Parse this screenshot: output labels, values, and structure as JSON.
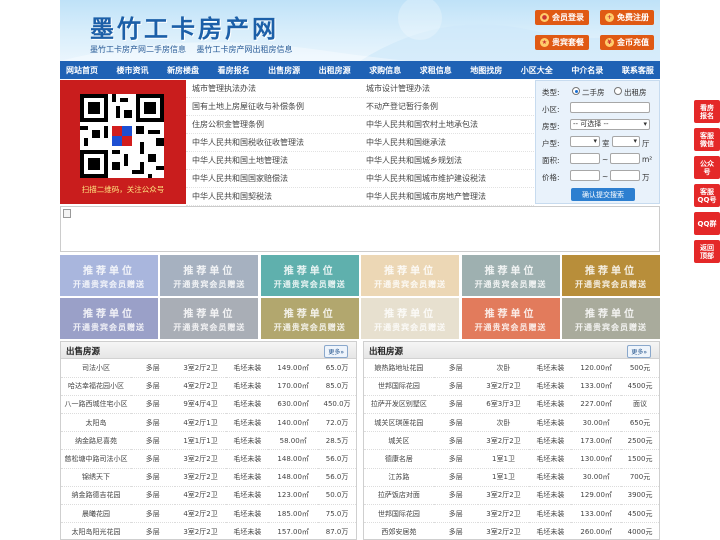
{
  "site": {
    "logo_text": "墨竹工卡房产网",
    "sublinks": [
      "墨竹工卡房产网二手房信息",
      "墨竹工卡房产网出租房信息"
    ],
    "buttons": [
      {
        "label": "会员登录",
        "icon": "user-icon"
      },
      {
        "label": "免费注册",
        "icon": "register-icon"
      },
      {
        "label": "贵宾套餐",
        "icon": "vip-icon"
      },
      {
        "label": "金币充值",
        "icon": "coin-icon"
      }
    ]
  },
  "nav": [
    "网站首页",
    "楼市资讯",
    "新房楼盘",
    "看房报名",
    "出售房源",
    "出租房源",
    "求购信息",
    "求租信息",
    "地图找房",
    "小区大全",
    "中介名录",
    "联系客服"
  ],
  "qr": {
    "caption": "扫描二维码，关注公众号"
  },
  "news_links": [
    [
      "城市管理执法办法",
      "城市设计管理办法"
    ],
    [
      "国有土地上房屋征收与补偿条例",
      "不动产登记暂行条例"
    ],
    [
      "住房公积金管理条例",
      "中华人民共和国农村土地承包法"
    ],
    [
      "中华人民共和国税收征收管理法",
      "中华人民共和国继承法"
    ],
    [
      "中华人民共和国土地管理法",
      "中华人民共和国城乡规划法"
    ],
    [
      "中华人民共和国国家赔偿法",
      "中华人民共和国城市维护建设税法"
    ],
    [
      "中华人民共和国契税法",
      "中华人民共和国城市房地产管理法"
    ]
  ],
  "search": {
    "type_label": "类型:",
    "type_options": [
      "二手房",
      "出租房"
    ],
    "community_label": "小区:",
    "community_value": "",
    "housetype_label": "房型:",
    "housetype_value": "-- 可选择 --",
    "layout_label": "户型:",
    "room_unit": "室",
    "hall_unit": "厅",
    "area_label": "面积:",
    "area_unit": "m²",
    "price_label": "价格:",
    "price_unit": "万",
    "range_sep": "~",
    "submit": "确认提交搜索"
  },
  "ads": {
    "line1": "推荐单位",
    "line2": "开通贵宾会员赠送",
    "colors": [
      "#a9b6dd",
      "#a6b1c0",
      "#5fb0ad",
      "#ecd7b5",
      "#9eb0b0",
      "#b88e3a",
      "#9aa0c8",
      "#a9aeb6",
      "#b2a76e",
      "#e7e0cf",
      "#e27b5c",
      "#a9ab9c"
    ]
  },
  "sale": {
    "title": "出售房源",
    "more": "更多»",
    "rows": [
      [
        "司法小区",
        "多层",
        "3室2厅2卫",
        "毛坯未装",
        "149.00㎡",
        "65.0万"
      ],
      [
        "哈达幸福花园小区",
        "多层",
        "4室2厅2卫",
        "170.00㎡",
        "85.0万"
      ],
      [
        "八一路西城住宅小区",
        "多层",
        "9室4厅4卫",
        "630.00㎡",
        "450.0万"
      ],
      [
        "太阳岛",
        "多层",
        "4室2厅1卫",
        "140.00㎡",
        "72.0万"
      ],
      [
        "纳金路尼喜苑",
        "多层",
        "1室1厅1卫",
        "58.00㎡",
        "28.5万"
      ],
      [
        "慈松塘中路司法小区",
        "多层",
        "3室2厅2卫",
        "148.00㎡",
        "56.0万"
      ],
      [
        "锦绣天下",
        "多层",
        "3室2厅2卫",
        "148.00㎡",
        "56.0万"
      ],
      [
        "纳金路德吉花园",
        "多层",
        "4室2厅2卫",
        "123.00㎡",
        "50.0万"
      ],
      [
        "晨曦花园",
        "多层",
        "4室2厅2卫",
        "185.00㎡",
        "75.0万"
      ],
      [
        "太阳岛阳光花园",
        "多层",
        "3室2厅2卫",
        "157.00㎡",
        "87.0万"
      ]
    ],
    "decor": "毛坯未装"
  },
  "rent": {
    "title": "出租房源",
    "more": "更多»",
    "rows": [
      [
        "娘热路地址花园",
        "多层",
        "次卧",
        "毛坯未装",
        "120.00㎡",
        "500元"
      ],
      [
        "世邦国际花园",
        "多层",
        "3室2厅2卫",
        "毛坯未装",
        "133.00㎡",
        "4500元"
      ],
      [
        "拉萨开发区别墅区",
        "多层",
        "6室3厅3卫",
        "毛坯未装",
        "227.00㎡",
        "面议"
      ],
      [
        "城关区琪莲花园",
        "多层",
        "次卧",
        "毛坯未装",
        "30.00㎡",
        "650元"
      ],
      [
        "城关区",
        "多层",
        "3室2厅2卫",
        "毛坯未装",
        "173.00㎡",
        "2500元"
      ],
      [
        "德康名居",
        "多层",
        "1室1卫",
        "毛坯未装",
        "130.00㎡",
        "1500元"
      ],
      [
        "江苏路",
        "多层",
        "1室1卫",
        "毛坯未装",
        "30.00㎡",
        "700元"
      ],
      [
        "拉萨饭店对面",
        "多层",
        "3室2厅2卫",
        "毛坯未装",
        "129.00㎡",
        "3900元"
      ],
      [
        "世邦国际花园",
        "多层",
        "3室2厅2卫",
        "毛坯未装",
        "133.00㎡",
        "4500元"
      ],
      [
        "西郊安居苑",
        "多层",
        "3室2厅2卫",
        "毛坯未装",
        "260.00㎡",
        "4000元"
      ]
    ]
  },
  "float": [
    "看房报名",
    "客服微信",
    "公众号",
    "客服QQ号",
    "QQ群",
    "返回顶部"
  ]
}
